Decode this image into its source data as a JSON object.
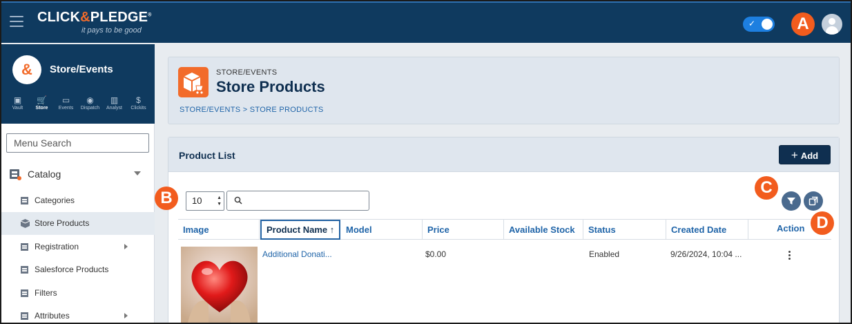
{
  "brand": {
    "logo_prefix": "CLICK",
    "logo_amp": "&",
    "logo_suffix": "PLEDGE",
    "logo_mark": "®",
    "tagline": "it pays to be good"
  },
  "callouts": {
    "a": "A",
    "b": "B",
    "c": "C",
    "d": "D"
  },
  "sidebar": {
    "logo_glyph": "&",
    "title": "Store/Events",
    "nav": [
      {
        "label": "Vault",
        "glyph": "▣"
      },
      {
        "label": "Store",
        "glyph": "🛒"
      },
      {
        "label": "Events",
        "glyph": "▭"
      },
      {
        "label": "Dispatch",
        "glyph": "◉"
      },
      {
        "label": "Analyst",
        "glyph": "▥"
      },
      {
        "label": "Clickits",
        "glyph": "$"
      }
    ],
    "search_placeholder": "Menu Search",
    "catalog_label": "Catalog",
    "items": [
      {
        "label": "Categories"
      },
      {
        "label": "Store Products"
      },
      {
        "label": "Registration"
      },
      {
        "label": "Salesforce Products"
      },
      {
        "label": "Filters"
      },
      {
        "label": "Attributes"
      }
    ]
  },
  "header": {
    "section": "STORE/EVENTS",
    "title": "Store Products",
    "breadcrumb": "STORE/EVENTS > STORE PRODUCTS"
  },
  "list": {
    "title": "Product List",
    "add_label": "Add",
    "page_size": "10",
    "columns": [
      "Image",
      "Product Name",
      "Model",
      "Price",
      "Available Stock",
      "Status",
      "Created Date",
      "Action"
    ],
    "sort_arrow": "↑",
    "rows": [
      {
        "product_name": "Additional Donati...",
        "model": "",
        "price": "$0.00",
        "available_stock": "",
        "status": "Enabled",
        "created_date": "9/26/2024, 10:04 ..."
      }
    ]
  },
  "colors": {
    "topbar": "#0f3a5f",
    "accent_orange": "#f25c1e",
    "link_blue": "#1f64a8",
    "navy": "#0f2f50",
    "toggle_blue": "#1d7fe0"
  },
  "icons": {
    "menu": "hamburger-icon",
    "user": "user-avatar-icon",
    "search": "search-icon",
    "filter": "filter-icon",
    "export": "copy-export-icon",
    "more": "kebab-menu-icon",
    "expand": "chevron-down-icon"
  }
}
